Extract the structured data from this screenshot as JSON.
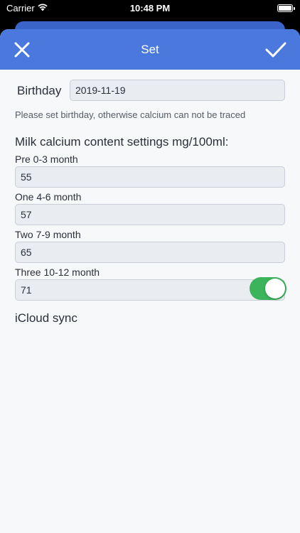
{
  "status_bar": {
    "carrier": "Carrier",
    "time": "10:48 PM"
  },
  "nav": {
    "title": "Set",
    "close_icon": "close-icon",
    "done_icon": "checkmark-icon"
  },
  "birthday": {
    "label": "Birthday",
    "value": "2019-11-19",
    "hint": "Please set birthday, otherwise calcium can not be traced"
  },
  "milk": {
    "heading": "Milk calcium content settings mg/100ml:",
    "stages": [
      {
        "label": "Pre 0-3 month",
        "value": "55"
      },
      {
        "label": "One 4-6 month",
        "value": "57"
      },
      {
        "label": "Two 7-9 month",
        "value": "65"
      },
      {
        "label": "Three 10-12 month",
        "value": "71"
      }
    ]
  },
  "icloud": {
    "label": "iCloud sync",
    "enabled": true
  },
  "colors": {
    "nav_blue": "#4a78dc",
    "toggle_on": "#3cb45c",
    "field_bg": "#e9ecf1"
  }
}
